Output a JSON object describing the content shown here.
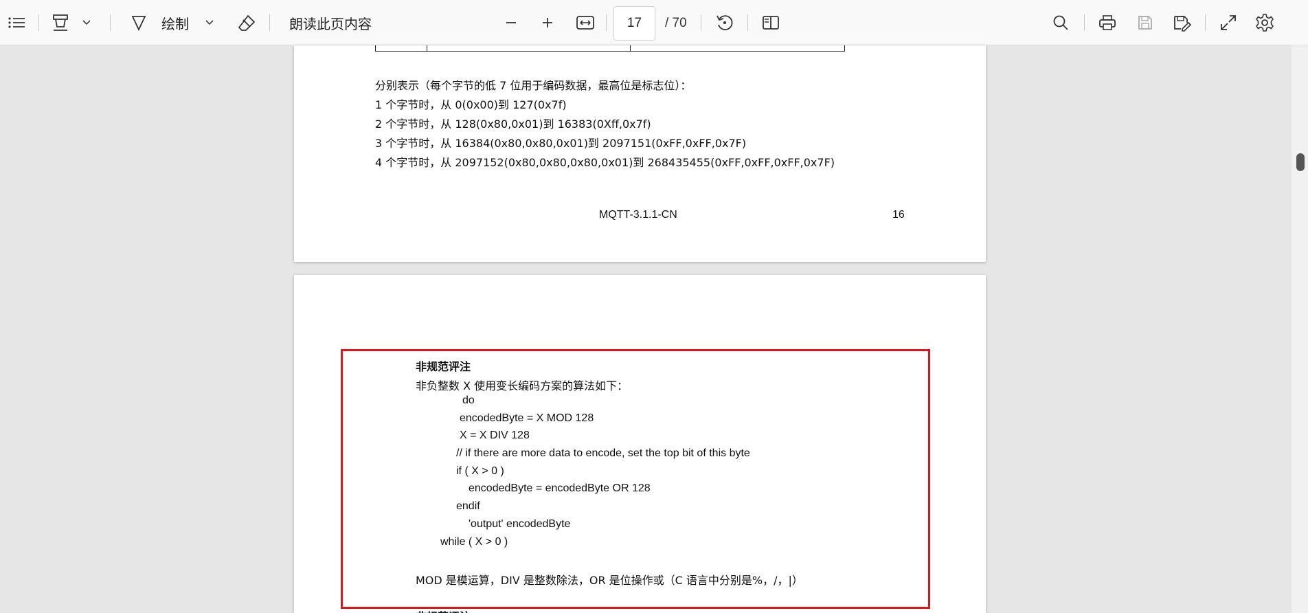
{
  "toolbar": {
    "draw_label": "绘制",
    "read_aloud_label": "朗读此页内容",
    "current_page": "17",
    "total_pages": "/ 70"
  },
  "page1": {
    "intro": "分别表示（每个字节的低 7 位用于编码数据，最高位是标志位）：",
    "ranges": [
      "1 个字节时，从 0(0x00)到 127(0x7f)",
      "2 个字节时，从 128(0x80,0x01)到 16383(0Xff,0x7f)",
      "3 个字节时，从 16384(0x80,0x80,0x01)到 2097151(0xFF,0xFF,0x7F)",
      "4 个字节时，从 2097152(0x80,0x80,0x80,0x01)到 268435455(0xFF,0xFF,0xFF,0x7F)"
    ],
    "footer_title": "MQTT-3.1.1-CN",
    "footer_page": "16"
  },
  "page2": {
    "heading": "非规范评注",
    "intro": "非负整数 X 使用变长编码方案的算法如下：",
    "code": [
      "do",
      "encodedByte = X MOD 128",
      "X = X DIV 128",
      "// if there are more data to encode, set the top bit of this byte",
      "if ( X > 0 )",
      "encodedByte = encodedByte OR 128",
      "endif",
      "'output' encodedByte",
      "while ( X > 0 )"
    ],
    "note": "MOD 是模运算，DIV 是整数除法，OR 是位操作或（C 语言中分别是%，/，|）",
    "next_heading": "非规范评注"
  }
}
